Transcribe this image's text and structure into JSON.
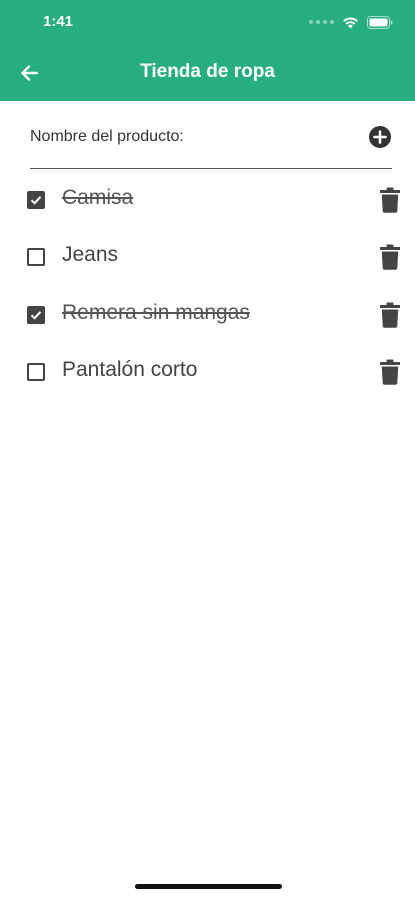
{
  "status_bar": {
    "time": "1:41",
    "icons": [
      "signal-icon",
      "wifi-icon",
      "battery-icon"
    ]
  },
  "app_bar": {
    "title": "Tienda de ropa",
    "back_icon": "arrow-left-icon",
    "background_color": "#26ad80"
  },
  "product_input": {
    "label": "Nombre del producto:",
    "value": "",
    "add_icon": "plus-circle-icon"
  },
  "items": [
    {
      "label": "Camisa",
      "checked": true
    },
    {
      "label": "Jeans",
      "checked": false
    },
    {
      "label": "Remera sin mangas",
      "checked": true
    },
    {
      "label": "Pantalón corto",
      "checked": false
    }
  ],
  "item_delete_icon": "trash-icon"
}
